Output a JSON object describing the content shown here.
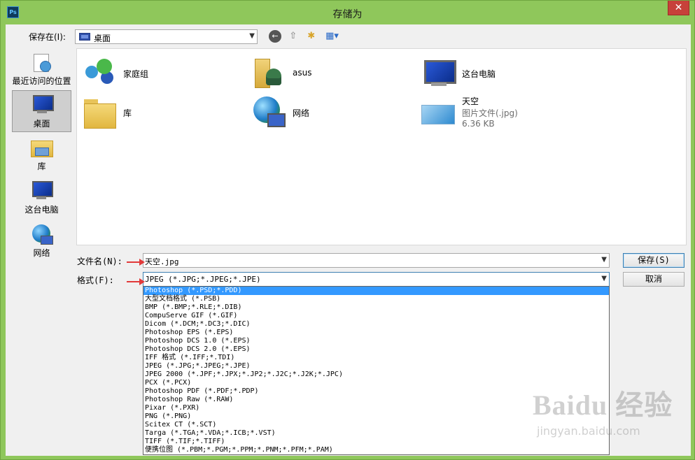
{
  "window": {
    "title": "存储为",
    "app_icon": "Ps",
    "close_glyph": "✕"
  },
  "toolbar": {
    "save_in_label": "保存在(I):",
    "save_in_value": "桌面",
    "icons": [
      "back-icon",
      "up-folder-icon",
      "new-folder-icon",
      "view-menu-icon"
    ]
  },
  "places": [
    {
      "label": "最近访问的位置",
      "icon": "recent-places-icon",
      "active": false
    },
    {
      "label": "桌面",
      "icon": "desktop-icon",
      "active": true
    },
    {
      "label": "库",
      "icon": "library-icon",
      "active": false
    },
    {
      "label": "这台电脑",
      "icon": "computer-icon",
      "active": false
    },
    {
      "label": "网络",
      "icon": "network-icon",
      "active": false
    }
  ],
  "files": [
    {
      "name": "家庭组",
      "icon": "homegroup-icon"
    },
    {
      "name": "asus",
      "icon": "user-folder-icon"
    },
    {
      "name": "这台电脑",
      "icon": "computer-icon"
    },
    {
      "name": "库",
      "icon": "library-folder-icon"
    },
    {
      "name": "网络",
      "icon": "network-icon"
    },
    {
      "name": "天空",
      "type": "图片文件(.jpg)",
      "size": "6.36 KB",
      "icon": "image-file-icon"
    }
  ],
  "form": {
    "filename_label": "文件名(N):",
    "filename_value": "天空.jpg",
    "format_label": "格式(F):",
    "format_value": "JPEG (*.JPG;*.JPEG;*.JPE)",
    "save_button": "保存(S)",
    "cancel_button": "取消"
  },
  "format_options": [
    "Photoshop (*.PSD;*.PDD)",
    "大型文档格式 (*.PSB)",
    "BMP (*.BMP;*.RLE;*.DIB)",
    "CompuServe GIF (*.GIF)",
    "Dicom (*.DCM;*.DC3;*.DIC)",
    "Photoshop EPS (*.EPS)",
    "Photoshop DCS 1.0 (*.EPS)",
    "Photoshop DCS 2.0 (*.EPS)",
    "IFF 格式 (*.IFF;*.TDI)",
    "JPEG (*.JPG;*.JPEG;*.JPE)",
    "JPEG 2000 (*.JPF;*.JPX;*.JP2;*.J2C;*.J2K;*.JPC)",
    "PCX (*.PCX)",
    "Photoshop PDF (*.PDF;*.PDP)",
    "Photoshop Raw (*.RAW)",
    "Pixar (*.PXR)",
    "PNG (*.PNG)",
    "Scitex CT (*.SCT)",
    "Targa (*.TGA;*.VDA;*.ICB;*.VST)",
    "TIFF (*.TIF;*.TIFF)",
    "便携位图 (*.PBM;*.PGM;*.PPM;*.PNM;*.PFM;*.PAM)"
  ],
  "highlighted_option_index": 0,
  "watermark": {
    "brand": "Baidu 经验",
    "sub": "jingyan.baidu.com"
  },
  "colors": {
    "frame": "#8fc75b",
    "close": "#c7413a",
    "highlight": "#3399ff",
    "annotation_arrow": "#e23a3a"
  }
}
